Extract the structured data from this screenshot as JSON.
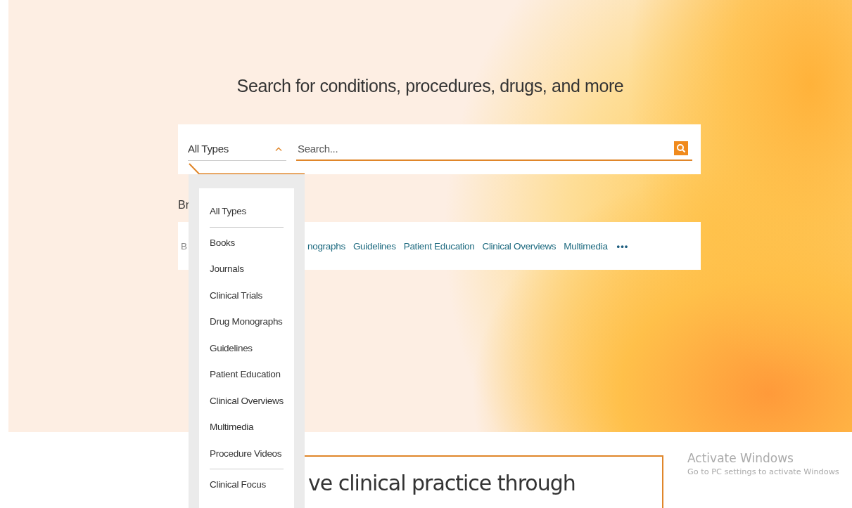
{
  "hero": {
    "heading": "Search for conditions, procedures, drugs, and more"
  },
  "search": {
    "type_select": {
      "value": "All Types",
      "expanded": true
    },
    "placeholder": "Search..."
  },
  "type_menu": {
    "sections": [
      {
        "items": [
          {
            "label": "All Types"
          }
        ]
      },
      {
        "items": [
          {
            "label": "Books"
          },
          {
            "label": "Journals"
          },
          {
            "label": "Clinical Trials"
          },
          {
            "label": "Drug Monographs"
          },
          {
            "label": "Guidelines"
          },
          {
            "label": "Patient Education"
          },
          {
            "label": "Clinical Overviews"
          },
          {
            "label": "Multimedia"
          },
          {
            "label": "Procedure Videos"
          }
        ]
      },
      {
        "items": [
          {
            "label": "Clinical Focus"
          }
        ]
      }
    ]
  },
  "browse": {
    "title": "Br",
    "links_before": [
      "B"
    ],
    "links": [
      "nographs",
      "Guidelines",
      "Patient Education",
      "Clinical Overviews",
      "Multimedia"
    ],
    "more": "•••"
  },
  "feature": {
    "heading": "ve clinical practice through"
  },
  "activation_notice": {
    "title": "Activate Windows",
    "message": "Go to PC settings to activate Windows"
  }
}
